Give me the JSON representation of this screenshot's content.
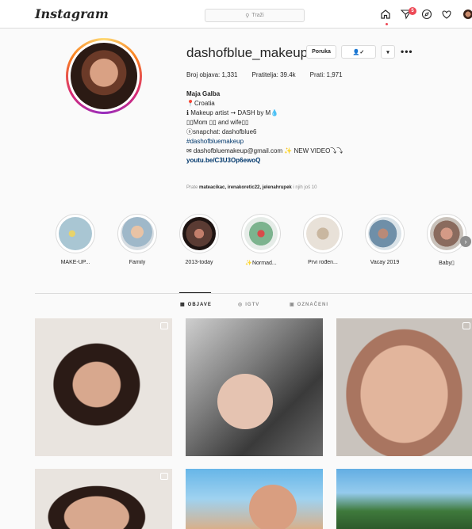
{
  "header": {
    "logo": "Instagram",
    "search_placeholder": "Traži",
    "notification_count": "5"
  },
  "profile": {
    "username": "dashofblue_makeup",
    "message_button": "Poruka",
    "stats": {
      "posts": "Broj objava: 1,331",
      "followers": "Pratitelja: 39.4k",
      "following": "Prati: 1,971"
    },
    "bio": {
      "name": "Maja Galba",
      "line1": "📍Croatia",
      "line2": "ℹ Makeup artist ➞ DASH by M💧",
      "line3": "▯▯Mom ▯▯ and wife▯▯",
      "line4": "ⓢsnapchat: dashofblue6",
      "hashtag": "#dashofbluemakeup",
      "line5": "✉ dashofbluemakeup@gmail.com ✨ NEW VIDEO⤵⤵",
      "link": "youtu.be/C3U3Op6ewoQ"
    },
    "followed_by": {
      "prefix": "Prate ",
      "users": "mateacikac, irenakoretic22, jelenahrupek",
      "suffix": " i njih još 10"
    }
  },
  "highlights": [
    {
      "label": "MAKE-UP..."
    },
    {
      "label": "Family"
    },
    {
      "label": "2013-today"
    },
    {
      "label": "✨Normad..."
    },
    {
      "label": "Prvi rođen..."
    },
    {
      "label": "Vacay 2019"
    },
    {
      "label": "Baby▯"
    }
  ],
  "tabs": {
    "posts": "OBJAVE",
    "igtv": "IGTV",
    "tagged": "OZNAČENI"
  },
  "colors": {
    "accent_link": "#00376b",
    "badge_red": "#ed4956",
    "border": "#dbdbdb"
  }
}
